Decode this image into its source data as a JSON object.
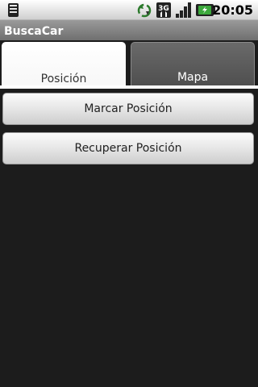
{
  "status_bar": {
    "time": "20:05",
    "network_type": "3G",
    "icons": [
      "notification-icon",
      "sync-icon",
      "network-3g-icon",
      "signal-strength-icon",
      "battery-charging-icon"
    ]
  },
  "app": {
    "title": "BuscaCar"
  },
  "tabs": [
    {
      "label": "Posición",
      "selected": true
    },
    {
      "label": "Mapa",
      "selected": false
    }
  ],
  "buttons": {
    "mark_position": "Marcar Posición",
    "recover_position": "Recuperar Posición"
  },
  "colors": {
    "background": "#1c1c1c",
    "selected_tab": "#ffffff",
    "unselected_tab": "#5a5a5a",
    "battery_accent": "#33aa33"
  }
}
